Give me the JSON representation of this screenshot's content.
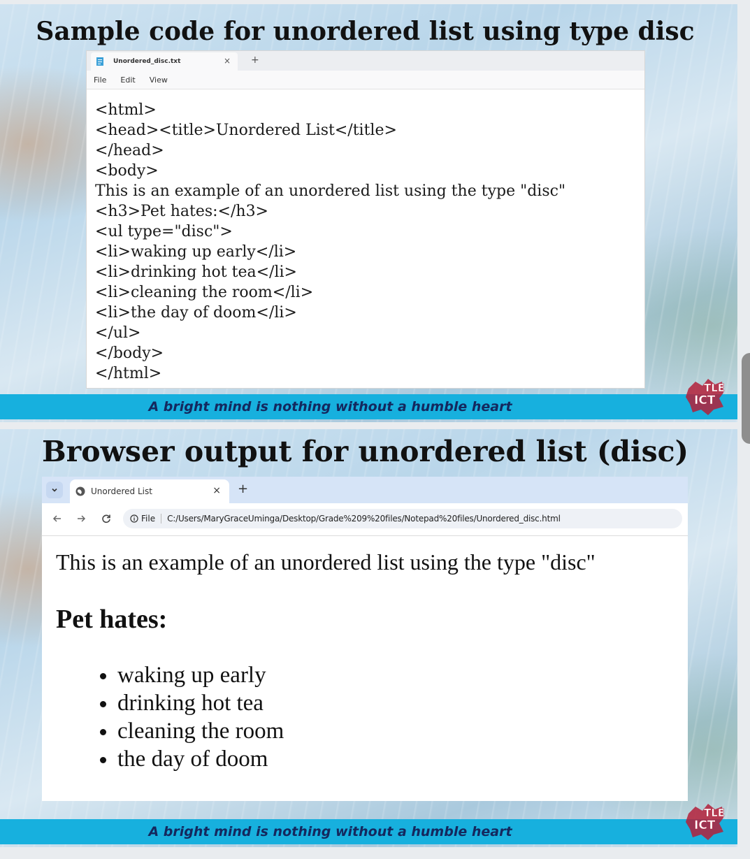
{
  "slide1": {
    "title": "Sample code for unordered list using type disc",
    "notepad": {
      "tab_name": "Unordered_disc.txt",
      "close_glyph": "×",
      "new_tab_glyph": "+",
      "menu": [
        "File",
        "Edit",
        "View"
      ],
      "code_lines": [
        "<html>",
        "<head><title>Unordered List</title>",
        "</head>",
        "<body>",
        "This is an example of an unordered list using the type \"disc\"",
        "<h3>Pet hates:</h3>",
        "<ul type=\"disc\">",
        "<li>waking up early</li>",
        "<li>drinking hot tea</li>",
        "<li>cleaning the room</li>",
        "<li>the day of doom</li>",
        "</ul>",
        "</body>",
        "</html>"
      ]
    },
    "footer": "A bright mind is nothing without a humble heart",
    "logo_text": [
      "TLE",
      "ICT"
    ]
  },
  "slide2": {
    "title": "Browser output for unordered list (disc)",
    "browser": {
      "tab_title": "Unordered List",
      "close_glyph": "×",
      "new_tab_glyph": "+",
      "url_label": "File",
      "url": "C:/Users/MaryGraceUminga/Desktop/Grade%209%20files/Notepad%20files/Unordered_disc.html",
      "page": {
        "paragraph": "This is an example of an unordered list using the type \"disc\"",
        "heading": "Pet hates:",
        "items": [
          "waking up early",
          "drinking hot tea",
          "cleaning the room",
          "the day of doom"
        ]
      }
    },
    "footer": "A bright mind is nothing without a humble heart",
    "logo_text": [
      "TLE",
      "ICT"
    ]
  },
  "colors": {
    "footer_band": "#17b0de",
    "footer_text": "#14285e",
    "logo_red": "#b3203a"
  },
  "icons": [
    "notepad-icon",
    "globe-icon",
    "back-arrow-icon",
    "forward-arrow-icon",
    "reload-icon",
    "info-icon",
    "chevron-down-icon"
  ]
}
